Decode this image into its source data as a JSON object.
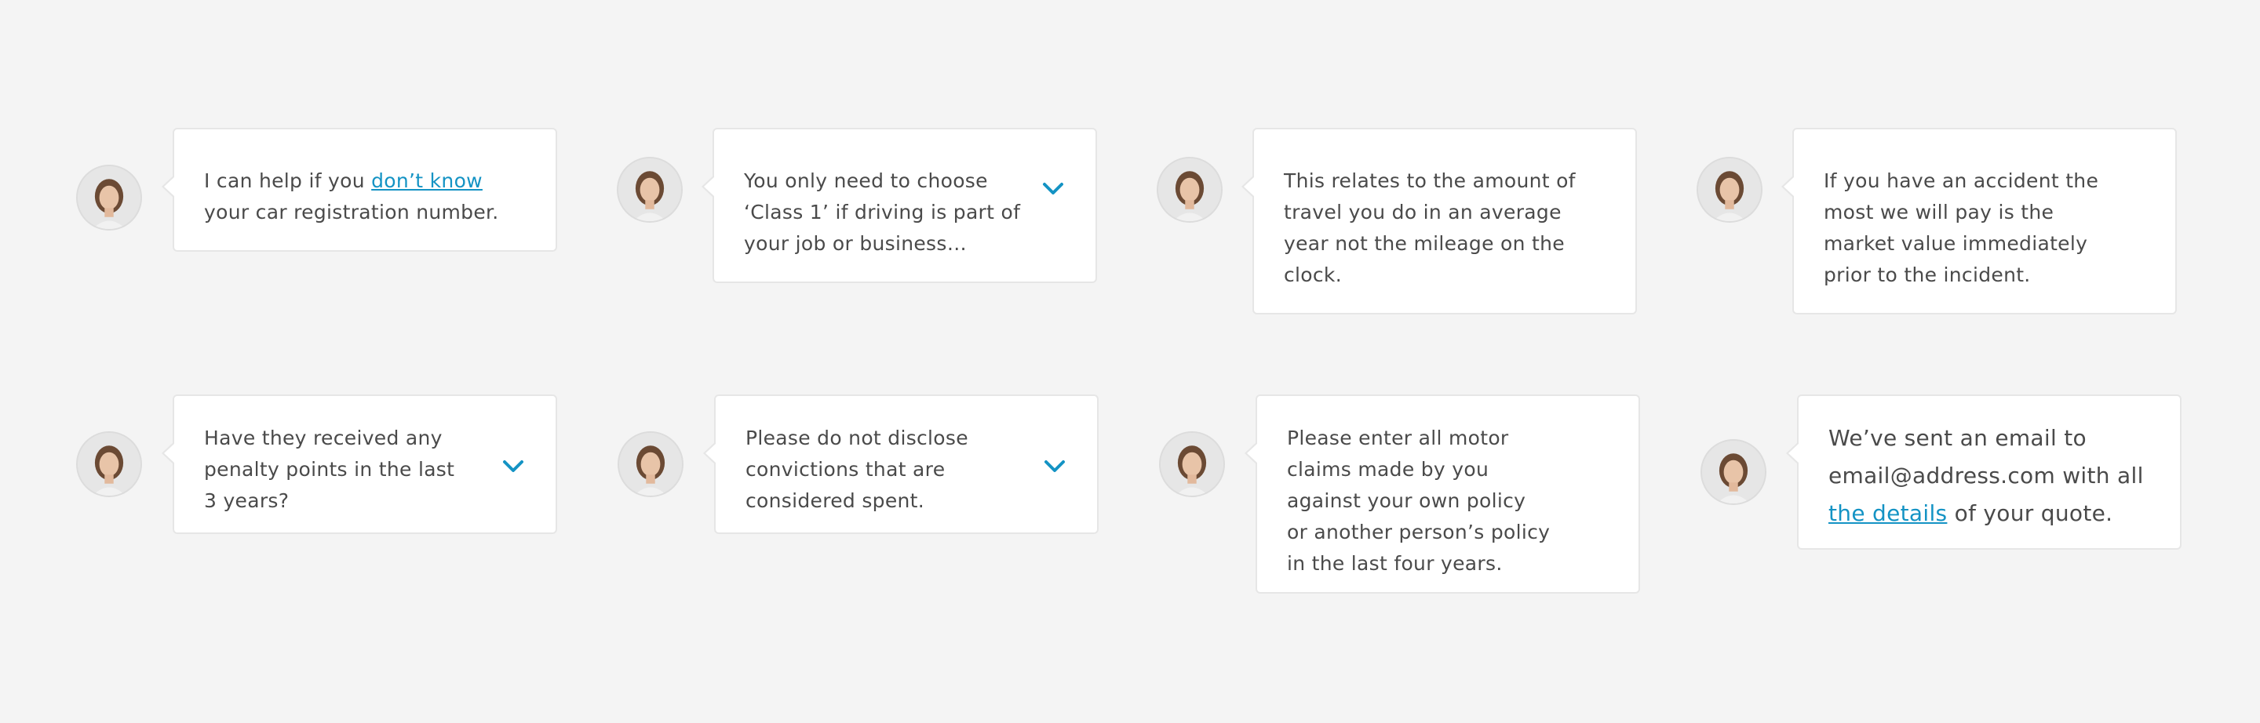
{
  "colors": {
    "background": "#f4f4f4",
    "bubble": "#ffffff",
    "border": "#e6e6e6",
    "text": "#4a4a4a",
    "accent": "#1493c4"
  },
  "messages": [
    {
      "id": "reg",
      "line1_pre": "I can help if you ",
      "line1_link": "don’t know",
      "line2": "your car registration number."
    },
    {
      "id": "class",
      "lines": [
        "You only need to choose",
        "‘Class 1’ if driving is part of",
        "your job or business…"
      ],
      "icon": "chevron-down-icon"
    },
    {
      "id": "mileage",
      "lines": [
        "This relates to the amount of",
        "travel you do in an average",
        "year not the mileage on the",
        "clock."
      ]
    },
    {
      "id": "value",
      "lines": [
        "If you have an accident the",
        "most we will pay is the",
        "market value immediately",
        "prior to the incident."
      ]
    },
    {
      "id": "points",
      "lines": [
        "Have they received any",
        "penalty points in the last",
        "3 years?"
      ],
      "icon": "chevron-down-icon"
    },
    {
      "id": "convictions",
      "lines": [
        "Please do not disclose",
        "convictions that are",
        "considered spent."
      ],
      "icon": "chevron-down-icon"
    },
    {
      "id": "claims",
      "lines": [
        "Please enter all motor",
        "claims made by you",
        "against your own policy",
        "or another person’s policy",
        "in the last four years."
      ]
    },
    {
      "id": "email",
      "line1": "We’ve sent an email to",
      "line2": "email@address.com with all",
      "line3_link": "the details",
      "line3_post": " of your quote."
    }
  ]
}
